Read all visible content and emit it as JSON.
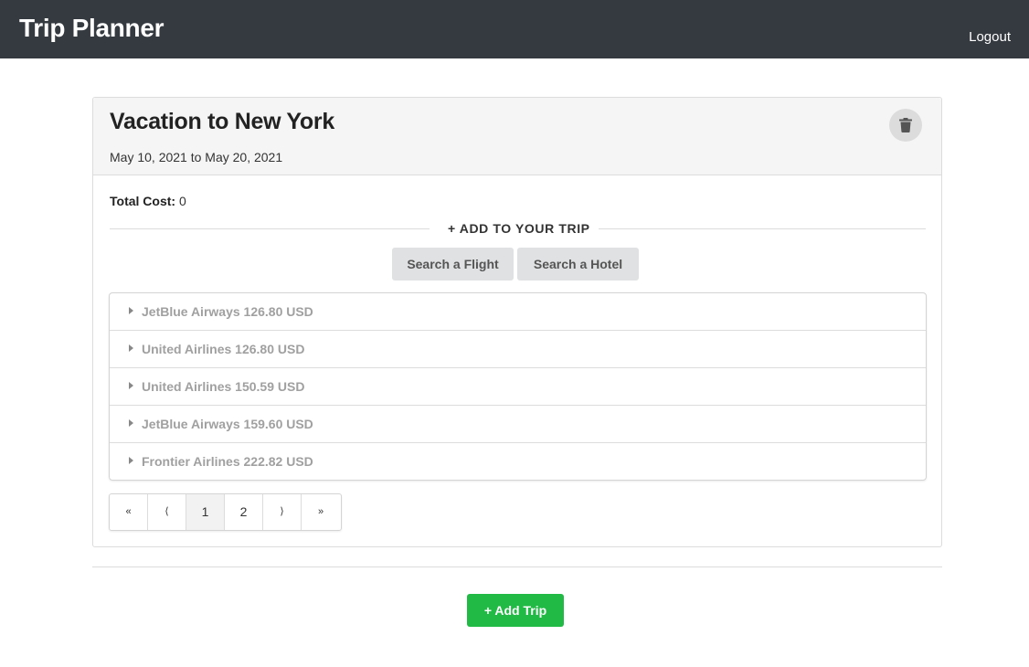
{
  "navbar": {
    "brand": "Trip Planner",
    "logout_label": "Logout",
    "background": "#343a40"
  },
  "trip": {
    "title": "Vacation to New York",
    "dates": "May 10, 2021 to May 20, 2021",
    "delete_icon": "trash-icon",
    "total_cost_label": "Total Cost:",
    "total_cost_value": "0",
    "add_section_label": "+ ADD TO YOUR TRIP",
    "search_flight_label": "Search a Flight",
    "search_hotel_label": "Search a Hotel",
    "flights": [
      "JetBlue Airways 126.80 USD",
      "United Airlines 126.80 USD",
      "United Airlines 150.59 USD",
      "JetBlue Airways 159.60 USD",
      "Frontier Airlines 222.82 USD"
    ],
    "pagination": {
      "first": "«",
      "prev": "⟨",
      "pages": [
        "1",
        "2"
      ],
      "active_page": "1",
      "next": "⟩",
      "last": "»"
    }
  },
  "add_trip_label": "+ Add Trip",
  "colors": {
    "accent_green": "#21ba45",
    "button_gray": "#e0e1e2"
  }
}
